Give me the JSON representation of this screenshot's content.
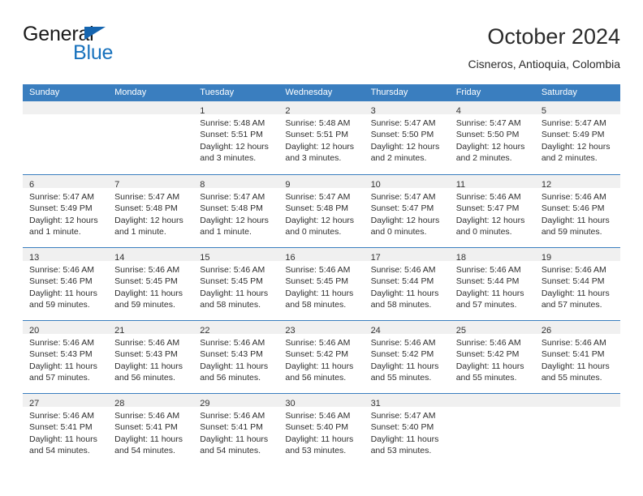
{
  "brand": {
    "name_part1": "General",
    "name_part2": "Blue",
    "triangle_color": "#1565b0",
    "blue_color": "#1872bd"
  },
  "header": {
    "title": "October 2024",
    "subtitle": "Cisneros, Antioquia, Colombia"
  },
  "theme": {
    "header_blue": "#3a7ebf",
    "day_band_gray": "#f0f0f0",
    "text_color": "#2e2e2e"
  },
  "weekdays": [
    "Sunday",
    "Monday",
    "Tuesday",
    "Wednesday",
    "Thursday",
    "Friday",
    "Saturday"
  ],
  "weeks": [
    [
      {
        "day": "",
        "sunrise": "",
        "sunset": "",
        "daylight": "",
        "empty": true
      },
      {
        "day": "",
        "sunrise": "",
        "sunset": "",
        "daylight": "",
        "empty": true
      },
      {
        "day": "1",
        "sunrise": "Sunrise: 5:48 AM",
        "sunset": "Sunset: 5:51 PM",
        "daylight": "Daylight: 12 hours and 3 minutes."
      },
      {
        "day": "2",
        "sunrise": "Sunrise: 5:48 AM",
        "sunset": "Sunset: 5:51 PM",
        "daylight": "Daylight: 12 hours and 3 minutes."
      },
      {
        "day": "3",
        "sunrise": "Sunrise: 5:47 AM",
        "sunset": "Sunset: 5:50 PM",
        "daylight": "Daylight: 12 hours and 2 minutes."
      },
      {
        "day": "4",
        "sunrise": "Sunrise: 5:47 AM",
        "sunset": "Sunset: 5:50 PM",
        "daylight": "Daylight: 12 hours and 2 minutes."
      },
      {
        "day": "5",
        "sunrise": "Sunrise: 5:47 AM",
        "sunset": "Sunset: 5:49 PM",
        "daylight": "Daylight: 12 hours and 2 minutes."
      }
    ],
    [
      {
        "day": "6",
        "sunrise": "Sunrise: 5:47 AM",
        "sunset": "Sunset: 5:49 PM",
        "daylight": "Daylight: 12 hours and 1 minute."
      },
      {
        "day": "7",
        "sunrise": "Sunrise: 5:47 AM",
        "sunset": "Sunset: 5:48 PM",
        "daylight": "Daylight: 12 hours and 1 minute."
      },
      {
        "day": "8",
        "sunrise": "Sunrise: 5:47 AM",
        "sunset": "Sunset: 5:48 PM",
        "daylight": "Daylight: 12 hours and 1 minute."
      },
      {
        "day": "9",
        "sunrise": "Sunrise: 5:47 AM",
        "sunset": "Sunset: 5:48 PM",
        "daylight": "Daylight: 12 hours and 0 minutes."
      },
      {
        "day": "10",
        "sunrise": "Sunrise: 5:47 AM",
        "sunset": "Sunset: 5:47 PM",
        "daylight": "Daylight: 12 hours and 0 minutes."
      },
      {
        "day": "11",
        "sunrise": "Sunrise: 5:46 AM",
        "sunset": "Sunset: 5:47 PM",
        "daylight": "Daylight: 12 hours and 0 minutes."
      },
      {
        "day": "12",
        "sunrise": "Sunrise: 5:46 AM",
        "sunset": "Sunset: 5:46 PM",
        "daylight": "Daylight: 11 hours and 59 minutes."
      }
    ],
    [
      {
        "day": "13",
        "sunrise": "Sunrise: 5:46 AM",
        "sunset": "Sunset: 5:46 PM",
        "daylight": "Daylight: 11 hours and 59 minutes."
      },
      {
        "day": "14",
        "sunrise": "Sunrise: 5:46 AM",
        "sunset": "Sunset: 5:45 PM",
        "daylight": "Daylight: 11 hours and 59 minutes."
      },
      {
        "day": "15",
        "sunrise": "Sunrise: 5:46 AM",
        "sunset": "Sunset: 5:45 PM",
        "daylight": "Daylight: 11 hours and 58 minutes."
      },
      {
        "day": "16",
        "sunrise": "Sunrise: 5:46 AM",
        "sunset": "Sunset: 5:45 PM",
        "daylight": "Daylight: 11 hours and 58 minutes."
      },
      {
        "day": "17",
        "sunrise": "Sunrise: 5:46 AM",
        "sunset": "Sunset: 5:44 PM",
        "daylight": "Daylight: 11 hours and 58 minutes."
      },
      {
        "day": "18",
        "sunrise": "Sunrise: 5:46 AM",
        "sunset": "Sunset: 5:44 PM",
        "daylight": "Daylight: 11 hours and 57 minutes."
      },
      {
        "day": "19",
        "sunrise": "Sunrise: 5:46 AM",
        "sunset": "Sunset: 5:44 PM",
        "daylight": "Daylight: 11 hours and 57 minutes."
      }
    ],
    [
      {
        "day": "20",
        "sunrise": "Sunrise: 5:46 AM",
        "sunset": "Sunset: 5:43 PM",
        "daylight": "Daylight: 11 hours and 57 minutes."
      },
      {
        "day": "21",
        "sunrise": "Sunrise: 5:46 AM",
        "sunset": "Sunset: 5:43 PM",
        "daylight": "Daylight: 11 hours and 56 minutes."
      },
      {
        "day": "22",
        "sunrise": "Sunrise: 5:46 AM",
        "sunset": "Sunset: 5:43 PM",
        "daylight": "Daylight: 11 hours and 56 minutes."
      },
      {
        "day": "23",
        "sunrise": "Sunrise: 5:46 AM",
        "sunset": "Sunset: 5:42 PM",
        "daylight": "Daylight: 11 hours and 56 minutes."
      },
      {
        "day": "24",
        "sunrise": "Sunrise: 5:46 AM",
        "sunset": "Sunset: 5:42 PM",
        "daylight": "Daylight: 11 hours and 55 minutes."
      },
      {
        "day": "25",
        "sunrise": "Sunrise: 5:46 AM",
        "sunset": "Sunset: 5:42 PM",
        "daylight": "Daylight: 11 hours and 55 minutes."
      },
      {
        "day": "26",
        "sunrise": "Sunrise: 5:46 AM",
        "sunset": "Sunset: 5:41 PM",
        "daylight": "Daylight: 11 hours and 55 minutes."
      }
    ],
    [
      {
        "day": "27",
        "sunrise": "Sunrise: 5:46 AM",
        "sunset": "Sunset: 5:41 PM",
        "daylight": "Daylight: 11 hours and 54 minutes."
      },
      {
        "day": "28",
        "sunrise": "Sunrise: 5:46 AM",
        "sunset": "Sunset: 5:41 PM",
        "daylight": "Daylight: 11 hours and 54 minutes."
      },
      {
        "day": "29",
        "sunrise": "Sunrise: 5:46 AM",
        "sunset": "Sunset: 5:41 PM",
        "daylight": "Daylight: 11 hours and 54 minutes."
      },
      {
        "day": "30",
        "sunrise": "Sunrise: 5:46 AM",
        "sunset": "Sunset: 5:40 PM",
        "daylight": "Daylight: 11 hours and 53 minutes."
      },
      {
        "day": "31",
        "sunrise": "Sunrise: 5:47 AM",
        "sunset": "Sunset: 5:40 PM",
        "daylight": "Daylight: 11 hours and 53 minutes."
      },
      {
        "day": "",
        "sunrise": "",
        "sunset": "",
        "daylight": "",
        "empty": true
      },
      {
        "day": "",
        "sunrise": "",
        "sunset": "",
        "daylight": "",
        "empty": true
      }
    ]
  ]
}
